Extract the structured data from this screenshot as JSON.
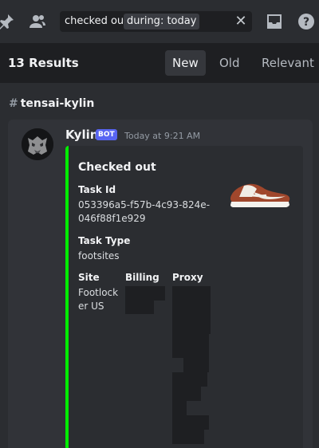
{
  "search": {
    "text": "checked out",
    "filter_chip": "during: today",
    "clear_symbol": "✕"
  },
  "results": {
    "count_label": "13 Results",
    "sort_tabs": [
      {
        "label": "New",
        "active": true
      },
      {
        "label": "Old",
        "active": false
      },
      {
        "label": "Relevant",
        "active": false
      }
    ]
  },
  "channel": {
    "hash": "#",
    "name": "tensai-kylin"
  },
  "message": {
    "author": "Kylin",
    "badge": "BOT",
    "timestamp": "Today at 9:21 AM",
    "embed": {
      "accent_color": "#00ee00",
      "title": "Checked out",
      "task_id_label": "Task Id",
      "task_id_value": "053396a5-f57b-4c93-824e-046f88f1e929",
      "task_type_label": "Task Type",
      "task_type_value": "footsites",
      "site_label": "Site",
      "site_value": "Footlocker US",
      "billing_label": "Billing",
      "proxy_label": "Proxy"
    }
  },
  "icons": [
    "pin-icon",
    "members-icon",
    "inbox-icon",
    "help-icon",
    "bot-avatar",
    "sneaker-thumbnail"
  ]
}
